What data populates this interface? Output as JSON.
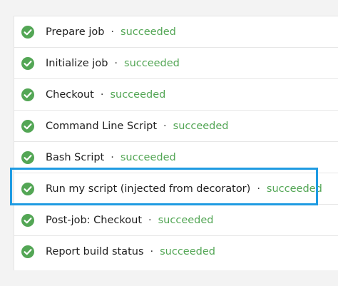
{
  "colors": {
    "success": "#53a655",
    "highlight": "#1f9be2"
  },
  "steps": [
    {
      "name": "Prepare job",
      "separator": "·",
      "status": "succeeded",
      "icon": "check-circle-icon"
    },
    {
      "name": "Initialize job",
      "separator": "·",
      "status": "succeeded",
      "icon": "check-circle-icon"
    },
    {
      "name": "Checkout",
      "separator": "·",
      "status": "succeeded",
      "icon": "check-circle-icon"
    },
    {
      "name": "Command Line Script",
      "separator": "·",
      "status": "succeeded",
      "icon": "check-circle-icon"
    },
    {
      "name": "Bash Script",
      "separator": "·",
      "status": "succeeded",
      "icon": "check-circle-icon"
    },
    {
      "name": "Run my script (injected from decorator)",
      "separator": "·",
      "status": "succeeded",
      "icon": "check-circle-icon"
    },
    {
      "name": "Post-job: Checkout",
      "separator": "·",
      "status": "succeeded",
      "icon": "check-circle-icon"
    },
    {
      "name": "Report build status",
      "separator": "·",
      "status": "succeeded",
      "icon": "check-circle-icon"
    }
  ]
}
